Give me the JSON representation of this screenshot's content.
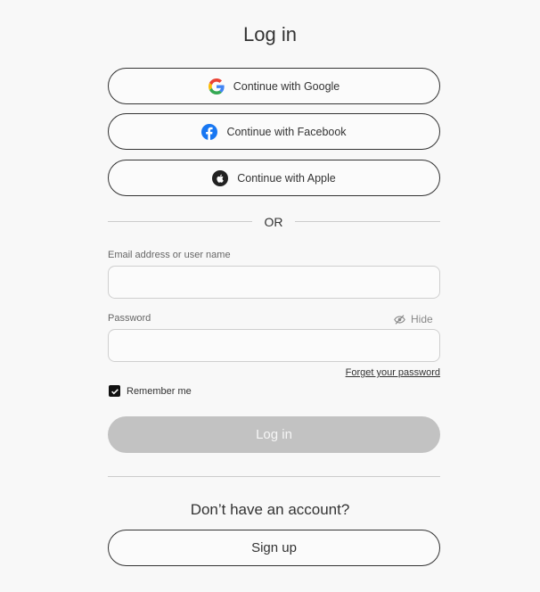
{
  "page": {
    "title": "Log in"
  },
  "social": {
    "google_label": "Continue with Google",
    "facebook_label": "Continue with Facebook",
    "apple_label": "Continue with Apple"
  },
  "divider": {
    "or_label": "OR"
  },
  "form": {
    "email_label": "Email address or user name",
    "email_value": "",
    "password_label": "Password",
    "password_value": "",
    "hide_label": "Hide",
    "forgot_label": "Forget your password",
    "remember_label": "Remember me",
    "remember_checked": true,
    "login_label": "Log in"
  },
  "signup": {
    "prompt": "Don’t have an account?",
    "button_label": "Sign up"
  },
  "icons": {
    "google": "google-icon",
    "facebook": "facebook-icon",
    "apple": "apple-icon",
    "hide": "eye-slash-icon",
    "checkbox": "checkmark-icon"
  },
  "colors": {
    "background": "#f8f8f8",
    "text": "#333333",
    "border": "#333333",
    "input_border": "#cfcfcf",
    "login_disabled_bg": "#c2c2c2",
    "facebook_blue": "#1877f2",
    "google_blue": "#4285f4",
    "google_red": "#ea4335",
    "google_yellow": "#fbbc05",
    "google_green": "#34a853"
  }
}
